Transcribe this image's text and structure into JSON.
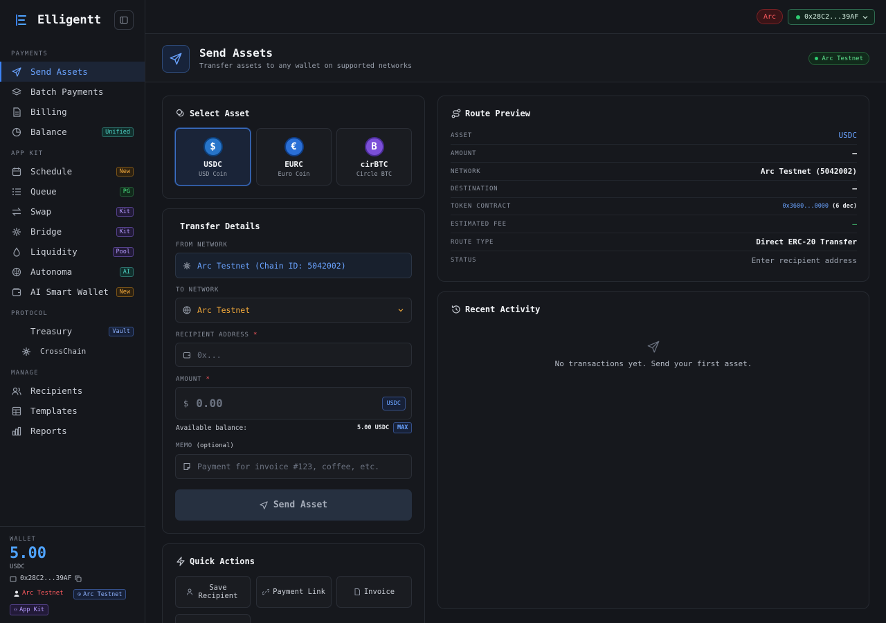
{
  "app": {
    "name": "Elligentt"
  },
  "sidebar": {
    "sections": {
      "payments": "PAYMENTS",
      "app_kit": "APP KIT",
      "protocol": "PROTOCOL",
      "manage": "MANAGE"
    },
    "items": [
      {
        "label": "Send Assets",
        "icon": "send-icon"
      },
      {
        "label": "Batch Payments",
        "icon": "layers-icon"
      },
      {
        "label": "Billing",
        "icon": "file-icon"
      },
      {
        "label": "Balance",
        "icon": "pie-icon",
        "badge": "Unified"
      },
      {
        "label": "Schedule",
        "icon": "calendar-icon",
        "badge": "New"
      },
      {
        "label": "Queue",
        "icon": "list-icon",
        "badge": "PG"
      },
      {
        "label": "Swap",
        "icon": "swap-icon",
        "badge": "Kit"
      },
      {
        "label": "Bridge",
        "icon": "bridge-icon",
        "badge": "Kit"
      },
      {
        "label": "Liquidity",
        "icon": "droplet-icon",
        "badge": "Pool"
      },
      {
        "label": "Autonoma",
        "icon": "brain-icon",
        "badge": "AI"
      },
      {
        "label": "AI Smart Wallet",
        "icon": "wallet-icon",
        "badge": "New"
      },
      {
        "label": "Treasury",
        "badge": "Vault"
      },
      {
        "label": "CrossChain",
        "icon": "asterisk-icon"
      },
      {
        "label": "Recipients",
        "icon": "users-icon"
      },
      {
        "label": "Templates",
        "icon": "template-icon"
      },
      {
        "label": "Reports",
        "icon": "bar-chart-icon"
      }
    ],
    "wallet": {
      "label": "WALLET",
      "balance": "5.00",
      "unit": "USDC",
      "address": "0x28C2...39AF",
      "chain": "Arc Testnet",
      "network": "Arc Testnet",
      "kit": "App Kit"
    }
  },
  "topbar": {
    "chain_pill": "Arc",
    "wallet": "0x28C2...39AF"
  },
  "page": {
    "title": "Send Assets",
    "subtitle": "Transfer assets to any wallet on supported networks",
    "network_badge": "Arc Testnet"
  },
  "select_asset": {
    "title": "Select Asset",
    "assets": [
      {
        "symbol": "USDC",
        "name": "USD Coin",
        "glyph": "$",
        "color": "#2775ca"
      },
      {
        "symbol": "EURC",
        "name": "Euro Coin",
        "glyph": "€",
        "color": "#2a6fd6"
      },
      {
        "symbol": "cirBTC",
        "name": "Circle BTC",
        "glyph": "B",
        "color": "#7b4fd8"
      }
    ]
  },
  "transfer": {
    "title": "Transfer Details",
    "from_label": "FROM NETWORK",
    "from_value": "Arc Testnet (Chain ID: 5042002)",
    "to_label": "TO NETWORK",
    "to_value": "Arc Testnet",
    "recipient_label": "RECIPIENT ADDRESS",
    "required_mark": "*",
    "recipient_placeholder": "0x...",
    "amount_label": "AMOUNT",
    "amount_currency": "$",
    "amount_placeholder": "0.00",
    "amount_unit": "USDC",
    "available_label": "Available balance:",
    "available_value": "5.00 USDC",
    "max_label": "MAX",
    "memo_label": "MEMO",
    "memo_optional": "(optional)",
    "memo_placeholder": "Payment for invoice #123, coffee, etc.",
    "send_button": "Send Asset"
  },
  "quick_actions": {
    "title": "Quick Actions",
    "items": [
      "Save Recipient",
      "Payment Link",
      "Invoice"
    ]
  },
  "route_preview": {
    "title": "Route Preview",
    "rows": [
      {
        "key": "ASSET",
        "value": "USDC"
      },
      {
        "key": "AMOUNT",
        "value": "—"
      },
      {
        "key": "NETWORK",
        "value": "Arc Testnet (5042002)"
      },
      {
        "key": "DESTINATION",
        "value": "—"
      },
      {
        "key": "TOKEN CONTRACT",
        "value": "0x3600...0000",
        "value_extra": "(6 dec)"
      },
      {
        "key": "ESTIMATED FEE",
        "value": "—"
      },
      {
        "key": "ROUTE TYPE",
        "value": "Direct ERC-20 Transfer"
      },
      {
        "key": "STATUS",
        "value": "Enter recipient address"
      }
    ]
  },
  "recent_activity": {
    "title": "Recent Activity",
    "empty": "No transactions yet. Send your first asset."
  }
}
